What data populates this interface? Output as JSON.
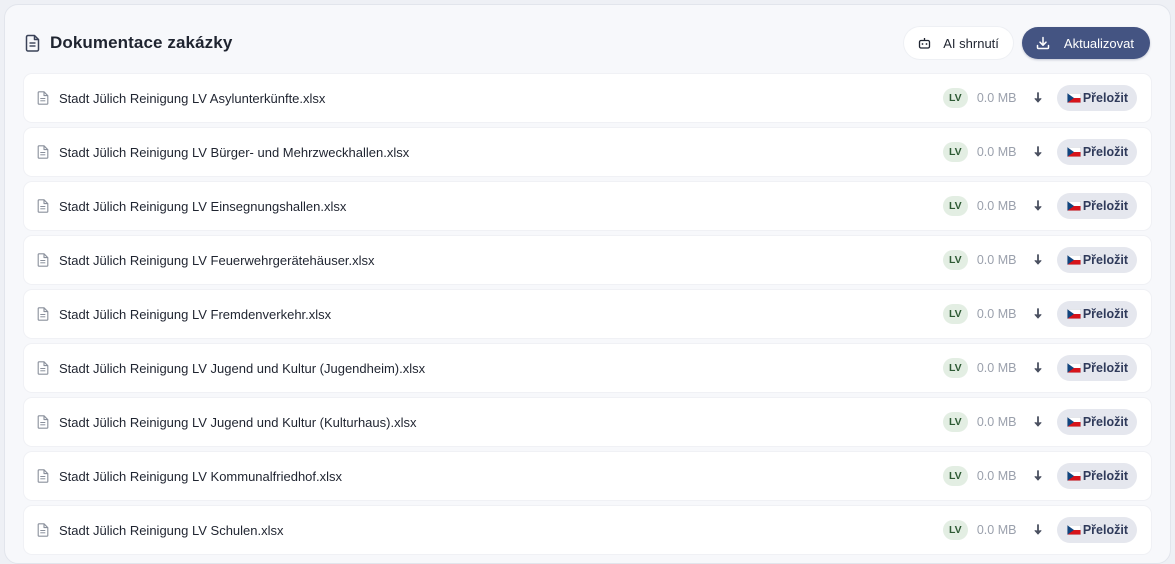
{
  "header": {
    "title": "Dokumentace zakázky",
    "ai_summary_label": "AI shrnutí",
    "update_label": "Aktualizovat"
  },
  "files": [
    {
      "name": "Stadt Jülich Reinigung LV Asylunterkünfte.xlsx",
      "badge": "LV",
      "size": "0.0 MB",
      "translate_label": "Přeložit"
    },
    {
      "name": "Stadt Jülich Reinigung LV Bürger- und Mehrzweckhallen.xlsx",
      "badge": "LV",
      "size": "0.0 MB",
      "translate_label": "Přeložit"
    },
    {
      "name": "Stadt Jülich Reinigung LV Einsegnungshallen.xlsx",
      "badge": "LV",
      "size": "0.0 MB",
      "translate_label": "Přeložit"
    },
    {
      "name": "Stadt Jülich Reinigung LV Feuerwehrgerätehäuser.xlsx",
      "badge": "LV",
      "size": "0.0 MB",
      "translate_label": "Přeložit"
    },
    {
      "name": "Stadt Jülich Reinigung LV Fremdenverkehr.xlsx",
      "badge": "LV",
      "size": "0.0 MB",
      "translate_label": "Přeložit"
    },
    {
      "name": "Stadt Jülich Reinigung LV Jugend und Kultur (Jugendheim).xlsx",
      "badge": "LV",
      "size": "0.0 MB",
      "translate_label": "Přeložit"
    },
    {
      "name": "Stadt Jülich Reinigung LV Jugend und Kultur (Kulturhaus).xlsx",
      "badge": "LV",
      "size": "0.0 MB",
      "translate_label": "Přeložit"
    },
    {
      "name": "Stadt Jülich Reinigung LV Kommunalfriedhof.xlsx",
      "badge": "LV",
      "size": "0.0 MB",
      "translate_label": "Přeložit"
    },
    {
      "name": "Stadt Jülich Reinigung LV Schulen.xlsx",
      "badge": "LV",
      "size": "0.0 MB",
      "translate_label": "Přeložit"
    }
  ],
  "icons": {
    "title": "document-icon",
    "ai": "robot-icon",
    "update": "download-icon",
    "file": "file-icon",
    "row_download": "arrow-down-icon",
    "flag": "czech-flag-icon"
  },
  "colors": {
    "primary": "#445482",
    "badge_bg": "#e3eee3",
    "badge_text": "#2e5a34",
    "translate_bg": "#e5e7ee"
  }
}
